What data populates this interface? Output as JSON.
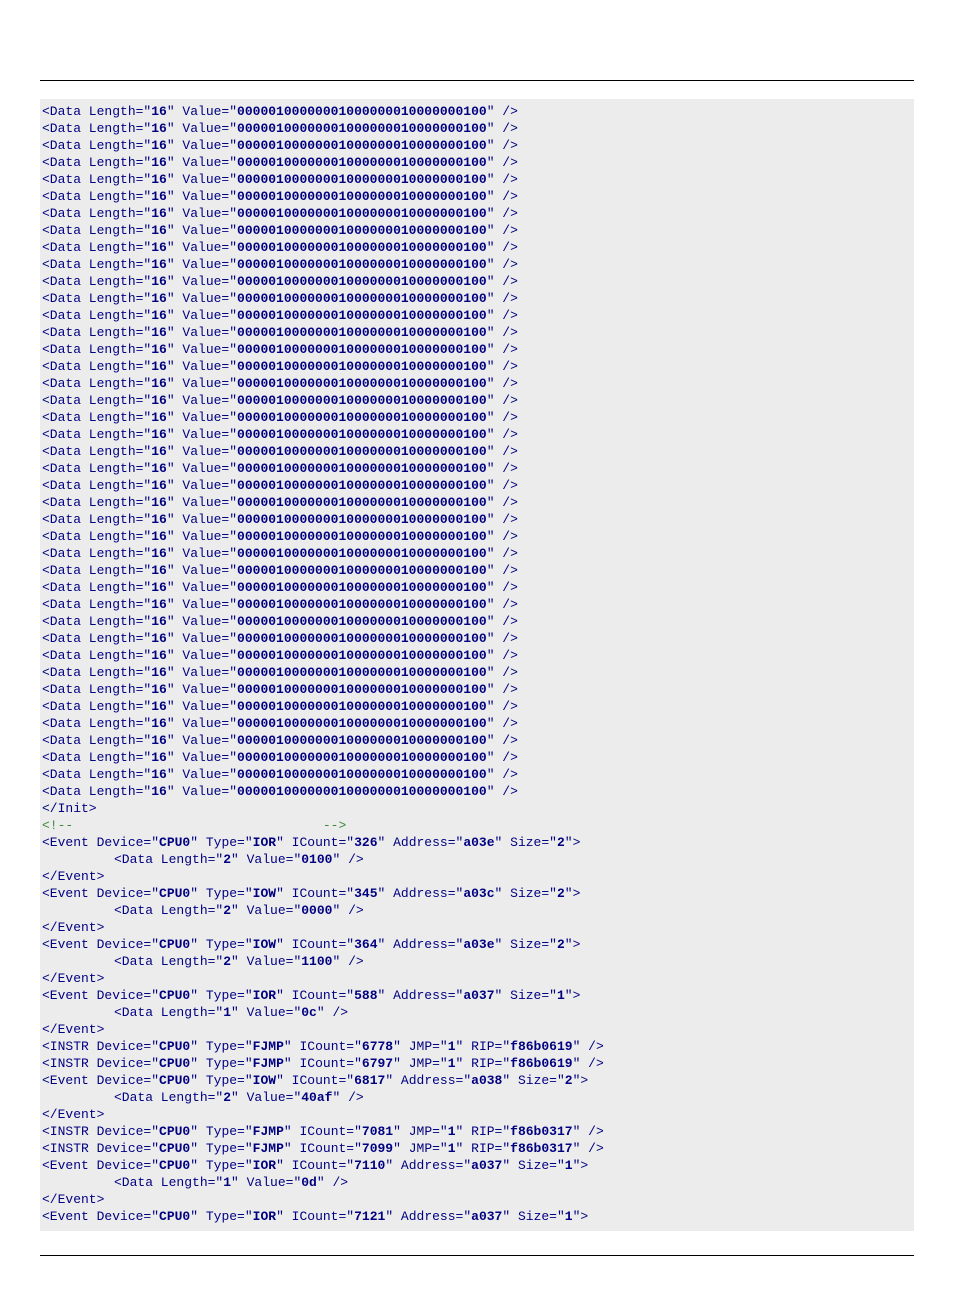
{
  "init": {
    "data_lines": {
      "count": 41,
      "length": "16",
      "value": "00000100000001000000010000000100"
    }
  },
  "comment": "<!--                                -->",
  "events": [
    {
      "kind": "Event",
      "device": "CPU0",
      "type": "IOR",
      "icount": "326",
      "address": "a03e",
      "size": "2",
      "data": {
        "length": "2",
        "value": "0100"
      }
    },
    {
      "kind": "Event",
      "device": "CPU0",
      "type": "IOW",
      "icount": "345",
      "address": "a03c",
      "size": "2",
      "data": {
        "length": "2",
        "value": "0000"
      }
    },
    {
      "kind": "Event",
      "device": "CPU0",
      "type": "IOW",
      "icount": "364",
      "address": "a03e",
      "size": "2",
      "data": {
        "length": "2",
        "value": "1100"
      }
    },
    {
      "kind": "Event",
      "device": "CPU0",
      "type": "IOR",
      "icount": "588",
      "address": "a037",
      "size": "1",
      "data": {
        "length": "1",
        "value": "0c"
      }
    },
    {
      "kind": "INSTR",
      "device": "CPU0",
      "type": "FJMP",
      "icount": "6778",
      "jmp": "1",
      "rip": "f86b0619"
    },
    {
      "kind": "INSTR",
      "device": "CPU0",
      "type": "FJMP",
      "icount": "6797",
      "jmp": "1",
      "rip": "f86b0619"
    },
    {
      "kind": "Event",
      "device": "CPU0",
      "type": "IOW",
      "icount": "6817",
      "address": "a038",
      "size": "2",
      "data": {
        "length": "2",
        "value": "40af"
      }
    },
    {
      "kind": "INSTR",
      "device": "CPU0",
      "type": "FJMP",
      "icount": "7081",
      "jmp": "1",
      "rip": "f86b0317"
    },
    {
      "kind": "INSTR",
      "device": "CPU0",
      "type": "FJMP",
      "icount": "7099",
      "jmp": "1",
      "rip": "f86b0317"
    },
    {
      "kind": "Event",
      "device": "CPU0",
      "type": "IOR",
      "icount": "7110",
      "address": "a037",
      "size": "1",
      "data": {
        "length": "1",
        "value": "0d"
      }
    },
    {
      "kind": "EventOpen",
      "device": "CPU0",
      "type": "IOR",
      "icount": "7121",
      "address": "a037",
      "size": "1"
    }
  ]
}
